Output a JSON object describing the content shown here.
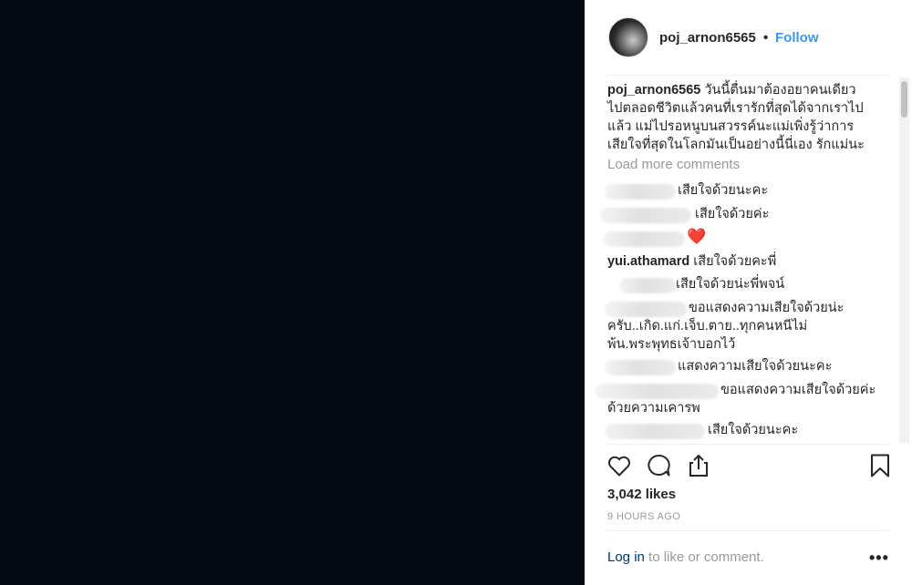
{
  "post": {
    "username": "poj_arnon6565",
    "follow_label": "Follow",
    "separator_dot": "•",
    "caption_lines": [
      "วันนี้ตื่นมาต้องอยาคนเดียว",
      "ไปตลอดชีวิตแล้วคนที่เรารักที่สุดได้จากเราไป",
      "แล้ว แม่ไปรอหนูบนสวรรค์นะแม่เพิ่งรู้ว่าการ",
      "เสียใจที่สุดในโลกมันเป็นอย่างนี้นี่เอง รักแม่นะ"
    ],
    "load_more_label": "Load more comments",
    "comments": [
      {
        "username": "",
        "lines": [
          "เสียใจด้วยนะคะ"
        ]
      },
      {
        "username": "",
        "lines": [
          "เสียใจด้วยค่ะ"
        ]
      },
      {
        "username": "",
        "lines": [
          "❤️"
        ]
      },
      {
        "username": "yui.athamard",
        "lines": [
          "เสียใจด้วยคะพี่"
        ]
      },
      {
        "username": "",
        "lines": [
          "เสียใจด้วยน่ะพี่พจน์"
        ]
      },
      {
        "username": "",
        "lines": [
          "ขอแสดงความเสียใจด้วยน่ะ",
          "ครับ..เกิด.แก่.เจ็บ.ตาย..ทุกคนหนีไม่",
          "พ้น.พระพุทธเจ้าบอกไว้"
        ]
      },
      {
        "username": "",
        "lines": [
          "แสดงความเสียใจด้วยนะคะ"
        ]
      },
      {
        "username": "",
        "lines": [
          "ขอแสดงความเสียใจด้วยค่ะ",
          "ด้วยความเคารพ"
        ]
      },
      {
        "username": "",
        "lines": [
          "เสียใจด้วยนะคะ"
        ]
      }
    ],
    "icons": {
      "like": "heart-icon",
      "comment": "comment-bubble-icon",
      "share": "share-icon",
      "save": "bookmark-icon",
      "more": "more-options-icon"
    },
    "likes": "3,042 likes",
    "time_ago": "9 HOURS AGO",
    "login_link": "Log in",
    "login_text": " to like or comment.",
    "more_label": "•••"
  },
  "colors": {
    "media_bg": "#050912",
    "link_blue": "#3897f0",
    "muted": "#999999",
    "text": "#262626"
  }
}
